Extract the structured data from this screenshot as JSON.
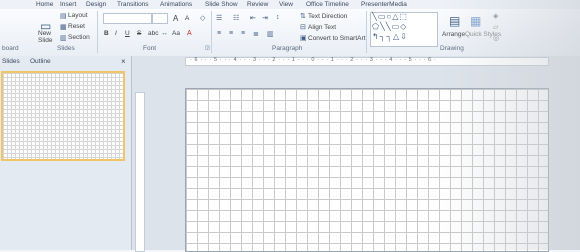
{
  "tabs": [
    "Home",
    "Insert",
    "Design",
    "Transitions",
    "Animations",
    "Slide Show",
    "Review",
    "View",
    "Office Timeline",
    "PresenterMedia"
  ],
  "slides_group": {
    "new_slide": "New",
    "new_slide2": "Slide",
    "layout": "Layout",
    "reset": "Reset",
    "section": "Section",
    "label": "Slides"
  },
  "font_group": {
    "label": "Font",
    "grow": "A",
    "shrink": "A",
    "bold": "B",
    "italic": "I",
    "underline": "U",
    "strike": "S",
    "shadow": "abc",
    "aa": "Aa"
  },
  "paragraph_group": {
    "label": "Paragraph",
    "text_direction": "Text Direction",
    "align_text": "Align Text",
    "smartart": "Convert to SmartArt"
  },
  "drawing_group": {
    "label": "Drawing",
    "arrange": "Arrange",
    "quick_styles": "Quick Styles"
  },
  "left_labels": {
    "clipboard": "board"
  },
  "panel_tabs": {
    "slides": "Slides",
    "outline": "Outline",
    "close": "×"
  },
  "ruler": {
    "top": "· 6 · · · 5 · · · 4 · · · 3 · · · 2 · · · 1 · · · 0 · · · 1 · · · 2 · · · 3 · · · 4 · · · 5 · · · 6 ·"
  }
}
